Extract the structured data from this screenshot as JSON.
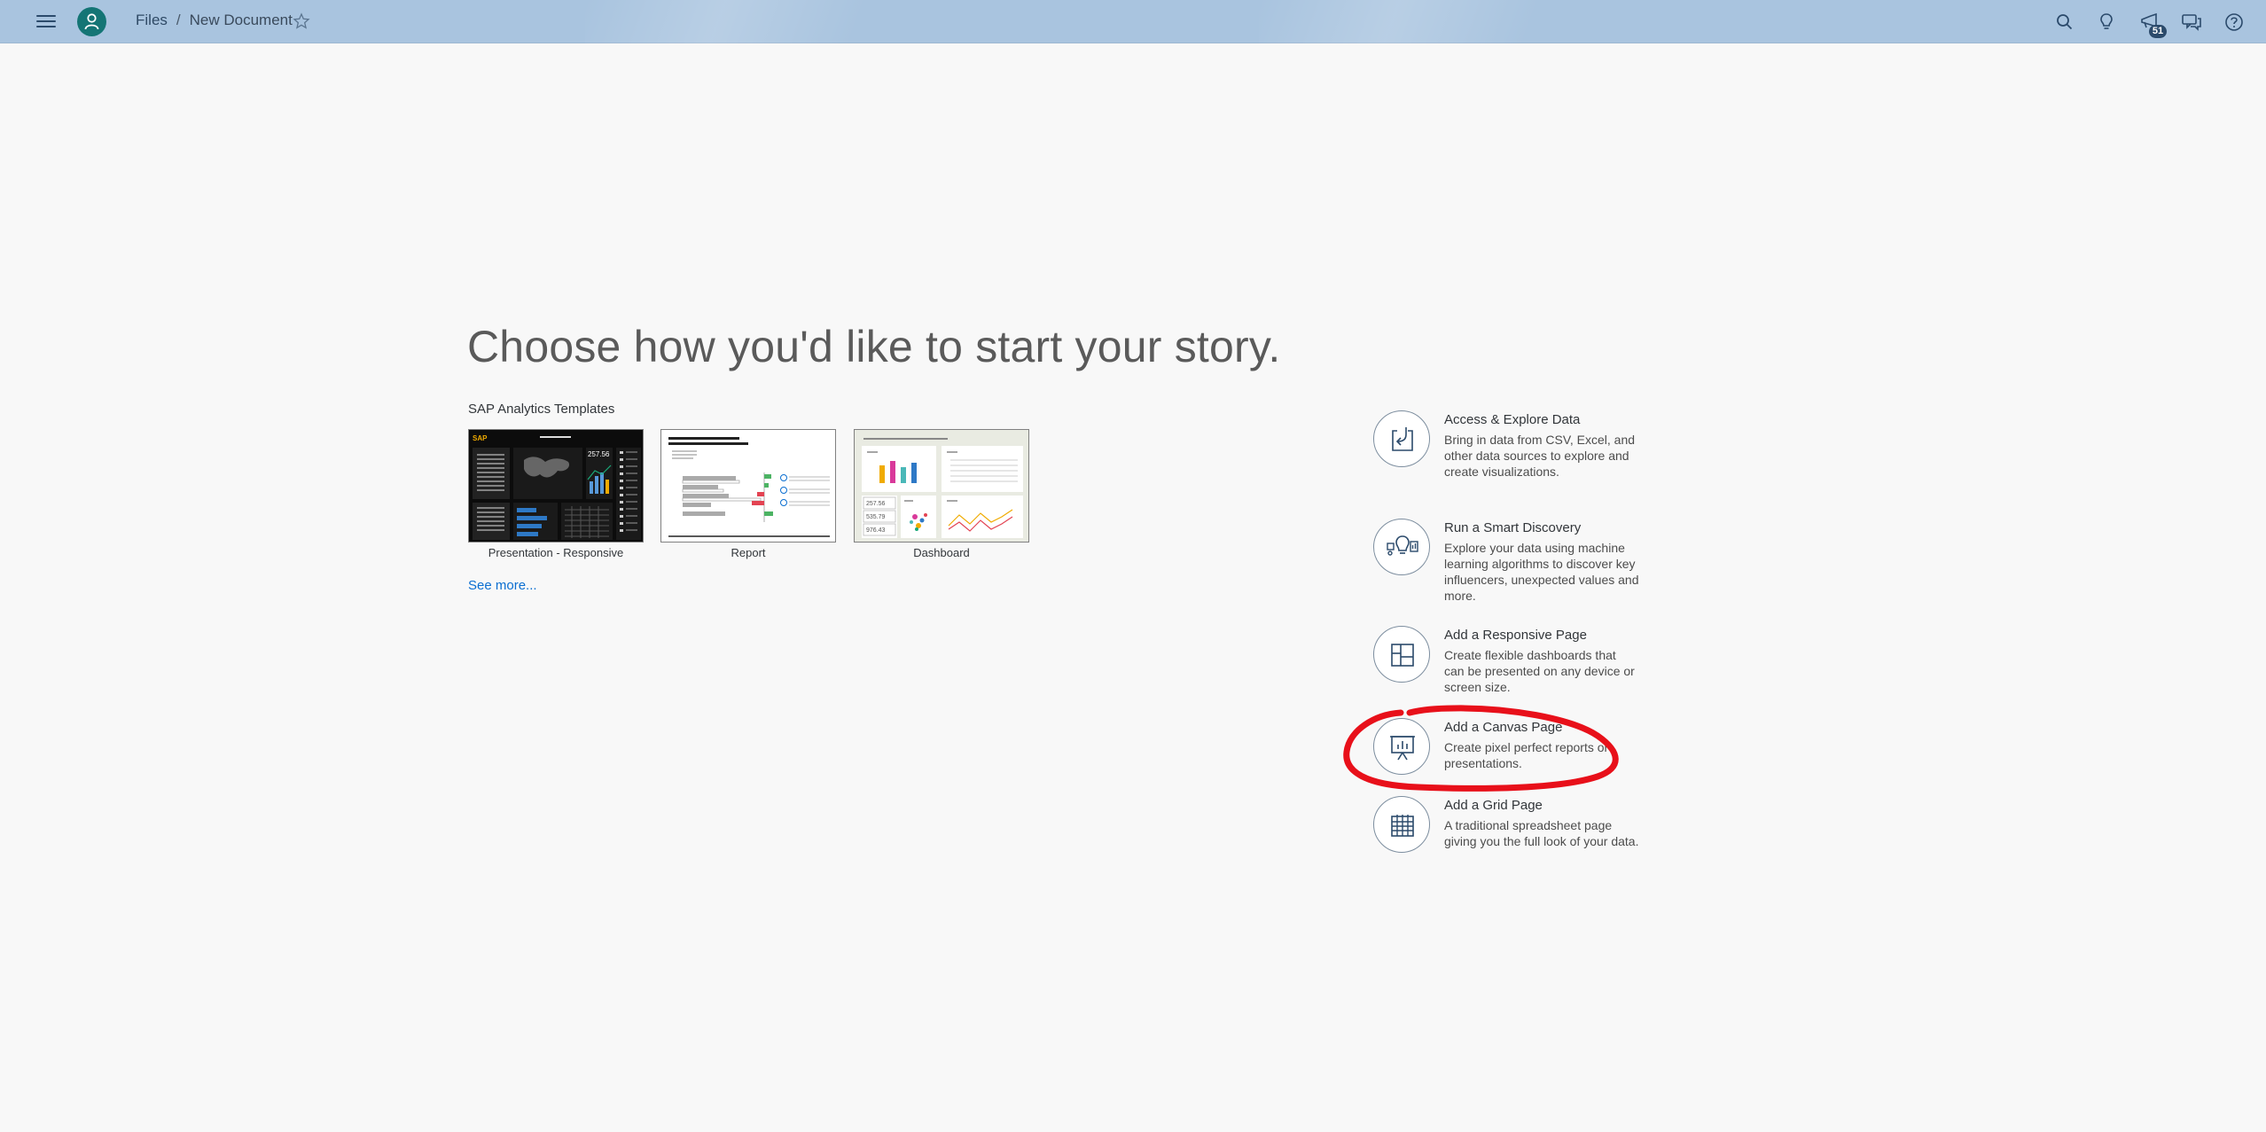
{
  "shellbar": {
    "breadcrumb_files": "Files",
    "breadcrumb_sep": "/",
    "breadcrumb_current": "New Document",
    "notification_count": "51"
  },
  "headline": "Choose how you'd like to start your story.",
  "templates": {
    "title": "SAP Analytics Templates",
    "items": [
      {
        "label": "Presentation - Responsive"
      },
      {
        "label": "Report"
      },
      {
        "label": "Dashboard"
      }
    ],
    "see_more": "See more...",
    "thumb_text": {
      "sap_logo": "SAP",
      "dark_value": "257.56",
      "dash_value_1": "257.56",
      "dash_value_2": "535.79",
      "dash_value_3": "976.43"
    }
  },
  "options": [
    {
      "title": "Access & Explore Data",
      "desc": "Bring in data from CSV, Excel, and other data sources to explore and create visualizations.",
      "icon": "import-data-icon"
    },
    {
      "title": "Run a Smart Discovery",
      "desc": "Explore your data using machine learning algorithms to discover key influencers, unexpected values and more.",
      "icon": "smart-discovery-icon"
    },
    {
      "title": "Add a Responsive Page",
      "desc": "Create flexible dashboards that can be presented on any device or screen size.",
      "icon": "responsive-page-icon"
    },
    {
      "title": "Add a Canvas Page",
      "desc": "Create pixel perfect reports or presentations.",
      "icon": "canvas-page-icon"
    },
    {
      "title": "Add a Grid Page",
      "desc": "A traditional spreadsheet page giving you the full look of your data.",
      "icon": "grid-page-icon"
    }
  ],
  "colors": {
    "shellbar": "#a9c4df",
    "avatar": "#147575",
    "link": "#0a6ed1",
    "annotation": "#e8101a"
  }
}
